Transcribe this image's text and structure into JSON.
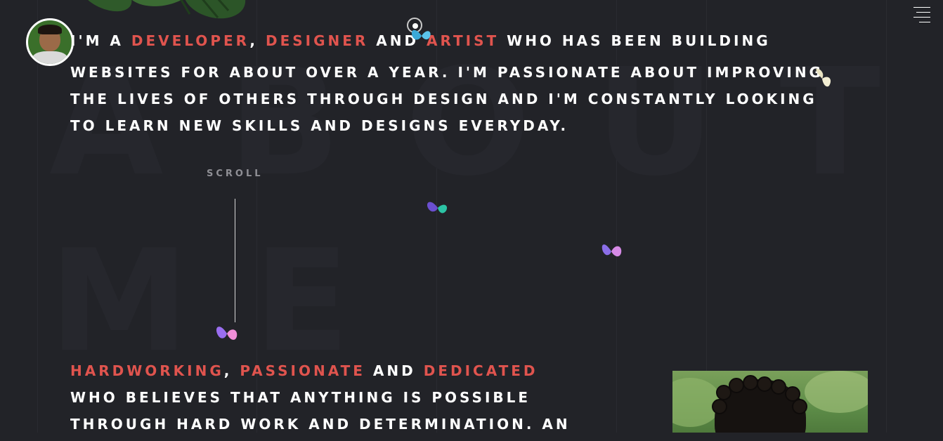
{
  "header": {
    "avatar_alt": "profile avatar",
    "menu_icon": "hamburger-menu-icon"
  },
  "background": {
    "word1": "ABOUT",
    "word2": "ME"
  },
  "intro": {
    "line1": {
      "prefix": "I'M A ",
      "role1": "DEVELOPER",
      "sep1": ", ",
      "role2": "DESIGNER",
      "sep2": " AND ",
      "role3": "ARTIST",
      "suffix": " WHO HAS BEEN BUILDING"
    },
    "line2": "WEBSITES FOR ABOUT OVER A YEAR. I'M PASSIONATE ABOUT IMPROVING",
    "line3": "THE LIVES OF OTHERS THROUGH DESIGN AND I'M CONSTANTLY LOOKING",
    "line4": "TO LEARN NEW SKILLS AND DESIGNS EVERYDAY."
  },
  "scroll": {
    "label": "SCROLL"
  },
  "traits": {
    "line1": {
      "trait1": "HARDWORKING",
      "sep1": ", ",
      "trait2": "PASSIONATE",
      "sep2": " AND ",
      "trait3": "DEDICATED"
    },
    "line2": "WHO BELIEVES THAT ANYTHING IS POSSIBLE",
    "line3": "THROUGH HARD WORK AND DETERMINATION. AN"
  },
  "colors": {
    "background": "#222328",
    "accent": "#e0544e",
    "text": "#ffffff"
  }
}
